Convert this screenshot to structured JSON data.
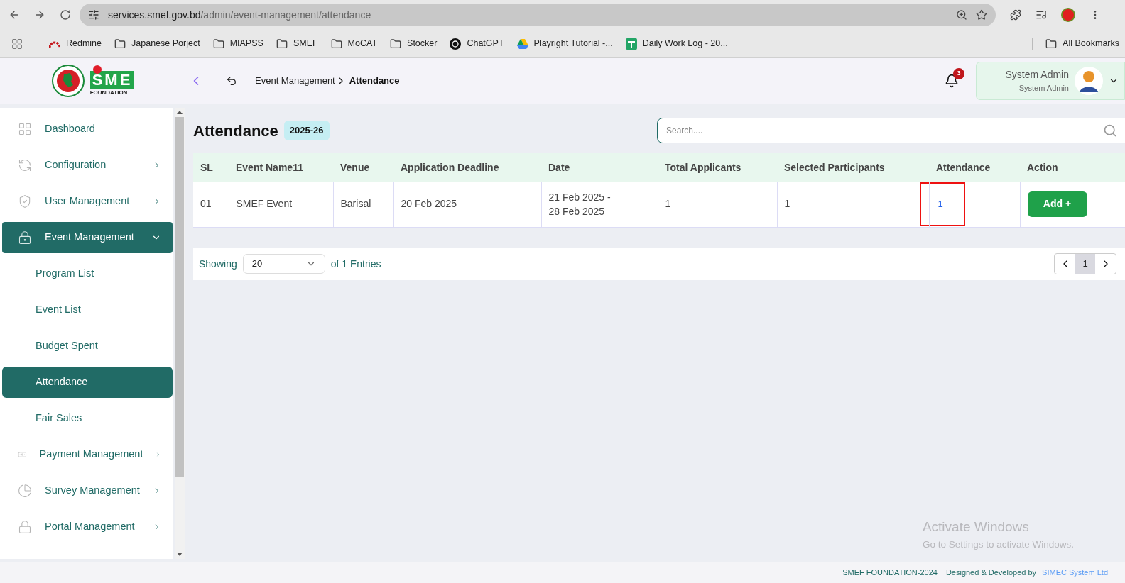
{
  "browser": {
    "url_host": "services.smef.gov.bd",
    "url_path": "/admin/event-management/attendance",
    "bookmarks": [
      {
        "kind": "redmine",
        "label": "Redmine"
      },
      {
        "kind": "folder",
        "label": "Japanese Porject"
      },
      {
        "kind": "folder",
        "label": "MIAPSS"
      },
      {
        "kind": "folder",
        "label": "SMEF"
      },
      {
        "kind": "folder",
        "label": "MoCAT"
      },
      {
        "kind": "folder",
        "label": "Stocker"
      },
      {
        "kind": "chatgpt",
        "label": "ChatGPT"
      },
      {
        "kind": "drive",
        "label": "Playright Tutorial -..."
      },
      {
        "kind": "sheets",
        "label": "Daily Work Log - 20..."
      }
    ],
    "all_bookmarks": "All Bookmarks"
  },
  "header": {
    "logo_word": "SME",
    "logo_sub": "FOUNDATION",
    "breadcrumb": [
      "Event Management",
      "Attendance"
    ],
    "notification_count": "3",
    "user_name": "System Admin",
    "user_role": "System Admin"
  },
  "sidebar": {
    "items": [
      {
        "label": "Dashboard",
        "kind": "link"
      },
      {
        "label": "Configuration",
        "kind": "group",
        "expanded": false
      },
      {
        "label": "User Management",
        "kind": "group",
        "expanded": false
      },
      {
        "label": "Event Management",
        "kind": "group",
        "expanded": true,
        "children": [
          {
            "label": "Program List",
            "selected": false
          },
          {
            "label": "Event List",
            "selected": false
          },
          {
            "label": "Budget Spent",
            "selected": false
          },
          {
            "label": "Attendance",
            "selected": true
          },
          {
            "label": "Fair Sales",
            "selected": false
          }
        ]
      },
      {
        "label": "Payment Management",
        "kind": "group",
        "expanded": false
      },
      {
        "label": "Survey Management",
        "kind": "group",
        "expanded": false
      },
      {
        "label": "Portal Management",
        "kind": "group",
        "expanded": false
      }
    ]
  },
  "page": {
    "title": "Attendance",
    "year_badge": "2025-26",
    "search": {
      "placeholder": "Search...."
    }
  },
  "table": {
    "columns": [
      "SL",
      "Event Name11",
      "Venue",
      "Application Deadline",
      "Date",
      "Total Applicants",
      "Selected Participants",
      "Attendance",
      "Action"
    ],
    "rows": [
      {
        "sl": "01",
        "event_name": "SMEF Event",
        "venue": "Barisal",
        "deadline": "20 Feb 2025",
        "date_lines": [
          "21 Feb 2025 -",
          "28 Feb 2025"
        ],
        "total_applicants": "1",
        "selected_participants": "1",
        "attendance": "1",
        "attendance_highlighted": true,
        "action": "Add +"
      }
    ]
  },
  "pagination": {
    "showing": "Showing",
    "page_size": "20",
    "entries": "of 1 Entries",
    "pages": [
      {
        "label": "1",
        "selected": true
      }
    ]
  },
  "footer": {
    "copyright": "SMEF FOUNDATION-2024",
    "designed_by": "Designed & Developed by",
    "developer": "SIMEC System Ltd"
  },
  "os_overlay": {
    "title": "Activate Windows",
    "subtitle": "Go to Settings to activate Windows."
  }
}
